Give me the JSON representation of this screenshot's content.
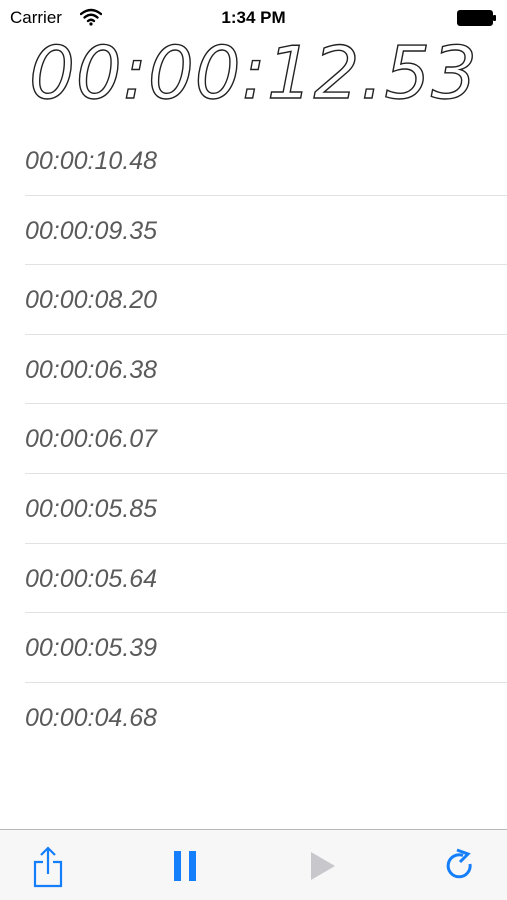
{
  "status_bar": {
    "carrier": "Carrier",
    "time": "1:34 PM"
  },
  "timer": {
    "display": "00:00:12.53"
  },
  "laps": [
    "00:00:10.48",
    "00:00:09.35",
    "00:00:08.20",
    "00:00:06.38",
    "00:00:06.07",
    "00:00:05.85",
    "00:00:05.64",
    "00:00:05.39",
    "00:00:04.68"
  ],
  "toolbar": {
    "share_icon": "share-icon",
    "pause_icon": "pause-icon",
    "play_icon": "play-icon",
    "reset_icon": "refresh-icon"
  },
  "colors": {
    "accent": "#147efb",
    "disabled": "#c7c7cc",
    "lap_text": "#5a5a5a"
  }
}
